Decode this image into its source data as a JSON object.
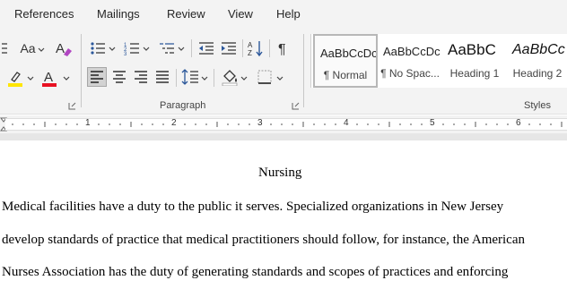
{
  "tabs": {
    "references": "References",
    "mailings": "Mailings",
    "review": "Review",
    "view": "View",
    "help": "Help"
  },
  "ribbon": {
    "font_size_label": "Aa",
    "groups": {
      "paragraph": "Paragraph",
      "styles": "Styles"
    },
    "colors": {
      "highlight": "#ffe500",
      "font_color": "#e81123",
      "selected_button_bg": "#d2d2d2"
    },
    "icons": [
      "change-case-icon",
      "clear-formatting-icon",
      "highlight-icon",
      "font-color-icon",
      "bullets-icon",
      "numbering-icon",
      "multilevel-list-icon",
      "decrease-indent-icon",
      "increase-indent-icon",
      "sort-icon",
      "show-formatting-marks-icon",
      "align-left-icon",
      "align-center-icon",
      "align-right-icon",
      "justify-icon",
      "line-spacing-icon",
      "shading-icon",
      "borders-icon"
    ]
  },
  "styles_gallery": [
    {
      "preview": "AaBbCcDc",
      "name": "¶ Normal",
      "selected": true
    },
    {
      "preview": "AaBbCcDc",
      "name": "¶ No Spac...",
      "selected": false
    },
    {
      "preview": "AaBbC",
      "name": "Heading 1",
      "selected": false
    },
    {
      "preview": "AaBbCc",
      "name": "Heading 2",
      "selected": false
    }
  ],
  "ruler": {
    "numbers": [
      "1",
      "2",
      "3",
      "4",
      "5",
      "6"
    ]
  },
  "document": {
    "title": "Nursing",
    "lines": [
      " Medical facilities have a duty to the public it serves. Specialized organizations in New Jersey",
      "develop standards of practice that medical practitioners should follow, for instance, the American",
      "Nurses Association has the duty of generating standards and scopes of practices and enforcing"
    ]
  }
}
